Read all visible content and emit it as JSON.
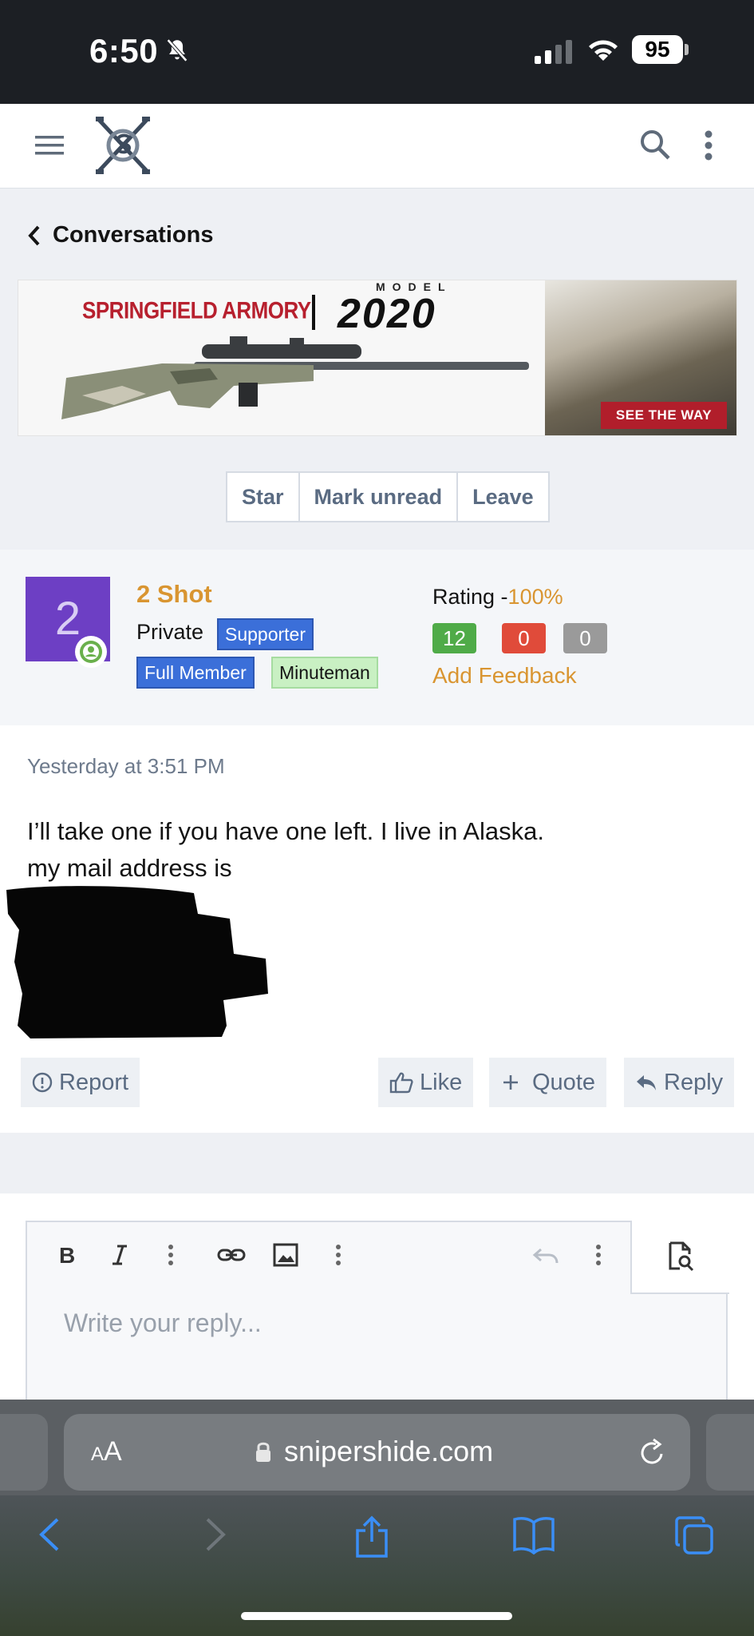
{
  "status": {
    "time": "6:50",
    "battery": "95"
  },
  "topnav": {
    "menu_icon": "hamburger-icon",
    "logo": "snipershide-logo",
    "search_icon": "search-icon",
    "more_icon": "kebab-icon"
  },
  "breadcrumb": {
    "label": "Conversations"
  },
  "ad": {
    "brand": "SPRINGFIELD ARMORY",
    "model_label": "MODEL",
    "model": "2020",
    "cta": "SEE THE WAY"
  },
  "conversation_actions": [
    {
      "label": "Star"
    },
    {
      "label": "Mark unread"
    },
    {
      "label": "Leave"
    }
  ],
  "user": {
    "avatar_letter": "2",
    "name": "2 Shot",
    "rank": "Private",
    "badges": [
      "Supporter",
      "Full Member",
      "Minuteman"
    ],
    "rating_label": "Rating -",
    "rating_value": "100%",
    "feedback_positive": "12",
    "feedback_negative": "0",
    "feedback_neutral": "0",
    "add_feedback": "Add Feedback",
    "colors": {
      "avatar": "#6d3fc4",
      "name": "#d99531",
      "badge_blue": "#3b6fd9",
      "badge_green": "#c9f0c3"
    }
  },
  "message": {
    "timestamp": "Yesterday at 3:51 PM",
    "line1": "I’ll take one if you have one left. I live in Alaska.",
    "line2": "my mail address is",
    "actions": {
      "report": "Report",
      "like": "Like",
      "quote": "Quote",
      "reply": "Reply"
    }
  },
  "editor": {
    "placeholder": "Write your reply..."
  },
  "safari": {
    "aa_small": "A",
    "aa_large": "A",
    "url": "snipershide.com"
  }
}
